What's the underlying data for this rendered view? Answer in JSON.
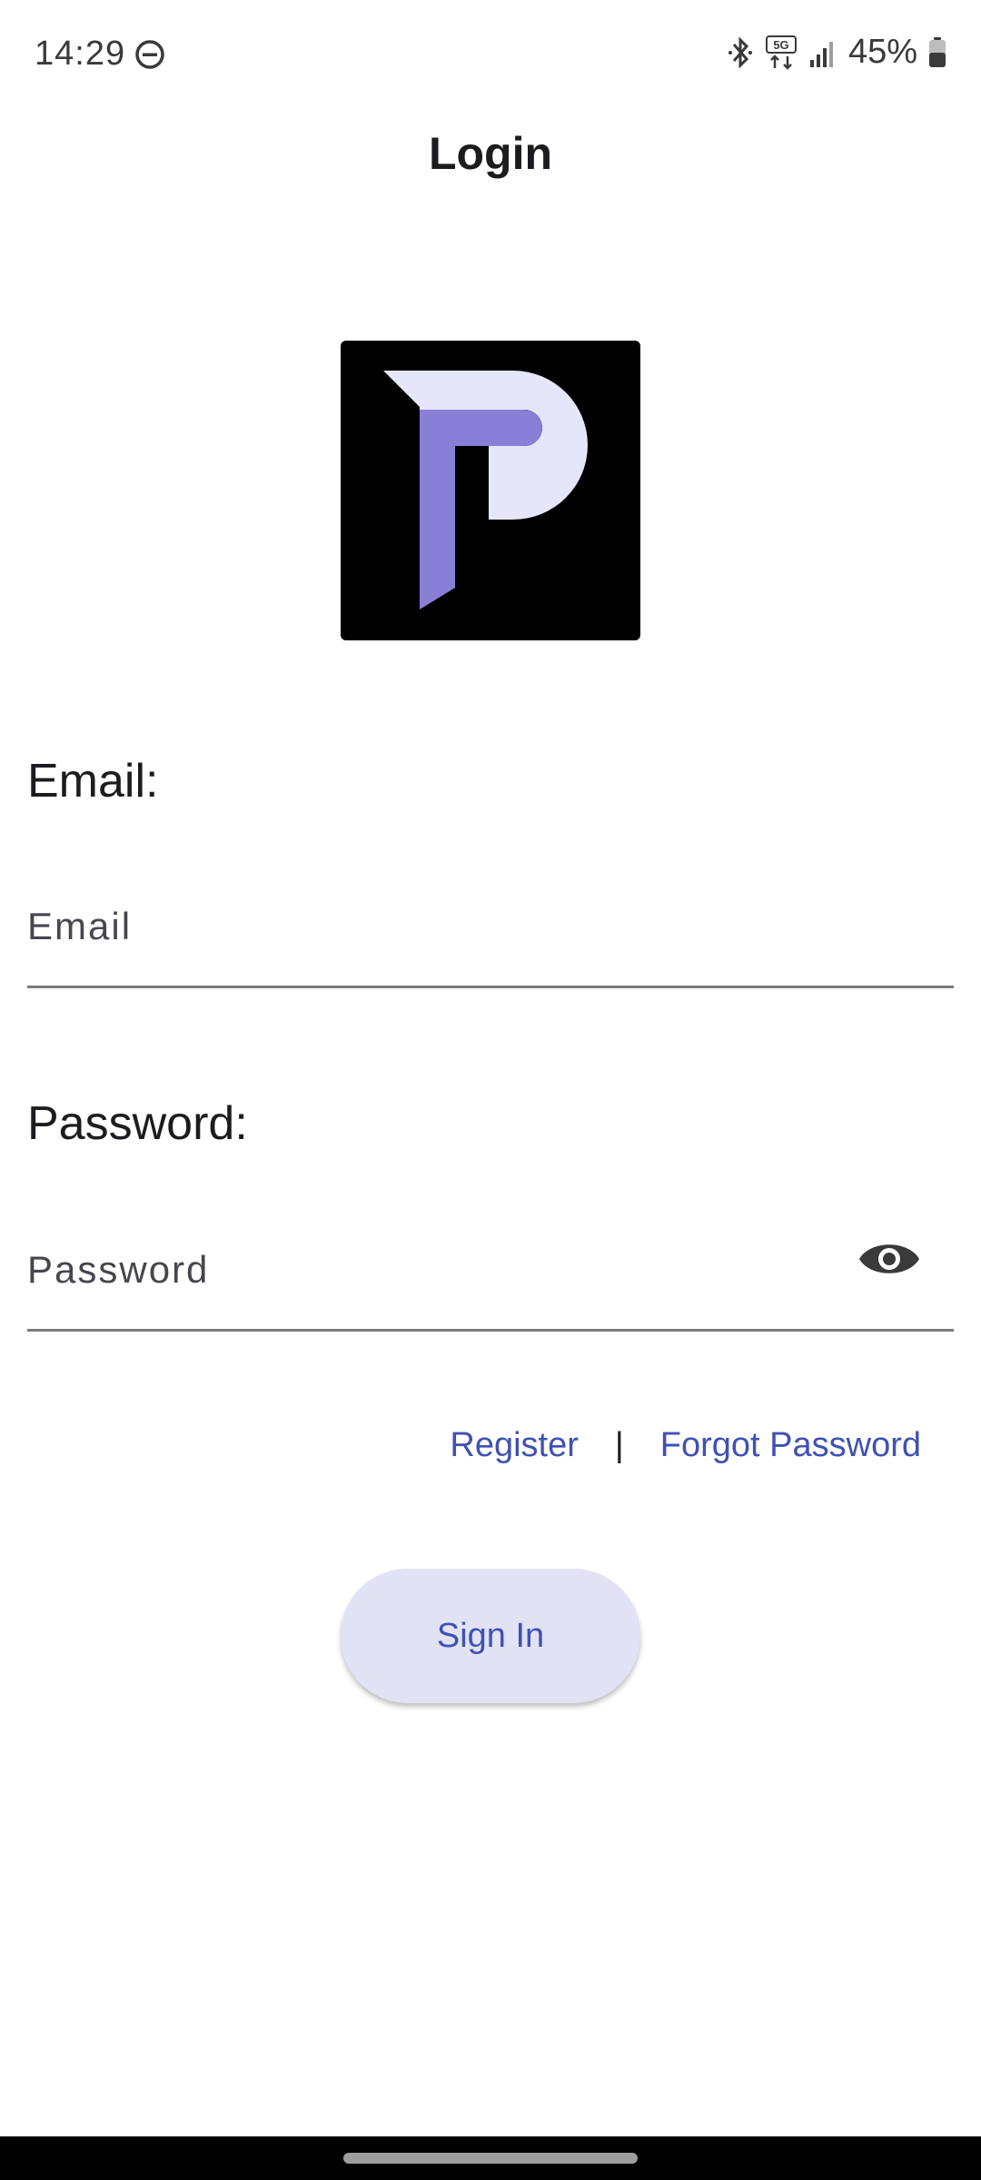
{
  "status_bar": {
    "time": "14:29",
    "network": "5G",
    "battery": "45%",
    "icons": [
      "do-not-disturb-icon",
      "bluetooth-icon",
      "5g-network-icon",
      "signal-icon",
      "battery-icon"
    ]
  },
  "header": {
    "title": "Login"
  },
  "logo": {
    "icon": "p-logo-icon",
    "colors": {
      "background": "#000000",
      "top": "#e6e6fa",
      "stem": "#8a7fd6"
    }
  },
  "form": {
    "email_label": "Email:",
    "email_placeholder": "Email",
    "email_value": "",
    "password_label": "Password:",
    "password_placeholder": "Password",
    "password_value": ""
  },
  "links": {
    "register": "Register",
    "divider": "|",
    "forgot_password": "Forgot Password"
  },
  "sign_in": {
    "label": "Sign In"
  },
  "colors": {
    "accent": "#3f51b5",
    "button_bg": "#e1e2f3",
    "text": "#1c1b1f",
    "underline": "#7a7a7a"
  }
}
